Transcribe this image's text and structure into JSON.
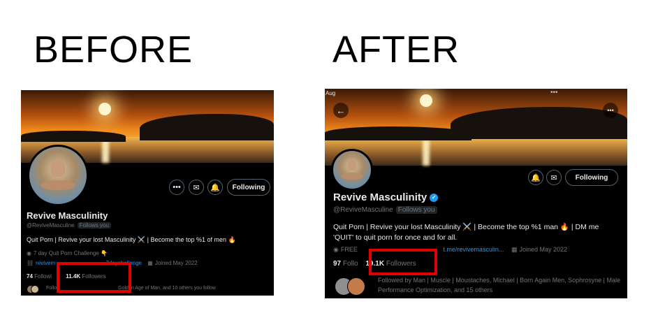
{
  "headings": {
    "before": "BEFORE",
    "after": "AFTER"
  },
  "colors": {
    "link": "#1d9bf0",
    "highlight_box": "#e00000",
    "card_bg": "#000000",
    "muted": "#71767b"
  },
  "before": {
    "name": "Revive Masculinity",
    "handle": "@ReviveMasculine",
    "follows_you": "Follows you",
    "bio": "Quit Porn | Revive your lost Masculinity ⚔️ | Become the top %1 of men 🔥",
    "meta_line1": "7 day Quit Porn Challenge 👇",
    "link_start": "revivem",
    "link_end": "7daychallenge",
    "joined": "Joined May 2022",
    "following_count": "74",
    "following_label": "Followi",
    "followers_count": "11.4K",
    "followers_label": "Followers",
    "followed_by_start": "Follo",
    "followed_by_end": "Golden Age of Man, and 10 others you follow",
    "button_follow": "Following",
    "icons": [
      "more-icon",
      "mail-icon",
      "notify-icon"
    ]
  },
  "after": {
    "status_bar": "Aug",
    "name": "Revive Masculinity",
    "handle": "@ReviveMasculine",
    "follows_you": "Follows you",
    "bio": "Quit Porn | Revive your lost Masculinity ⚔️ | Become the top %1 man 🔥 | DM me 'QUIT' to quit porn for once and for all.",
    "meta_group": "FREE",
    "link": "t.me/revivemasculin...",
    "joined": "Joined May 2022",
    "following_count": "97",
    "following_label": "Follo",
    "followers_count": "19.1K",
    "followers_label": "Followers",
    "followed_by": "Followed by Man | Muscle | Moustaches, Michael | Born Again Men, Sophrosyne | Male Performance Optimization, and 15 others",
    "button_follow": "Following",
    "icons": [
      "back-icon",
      "more-icon",
      "notify-icon",
      "mail-icon"
    ]
  }
}
